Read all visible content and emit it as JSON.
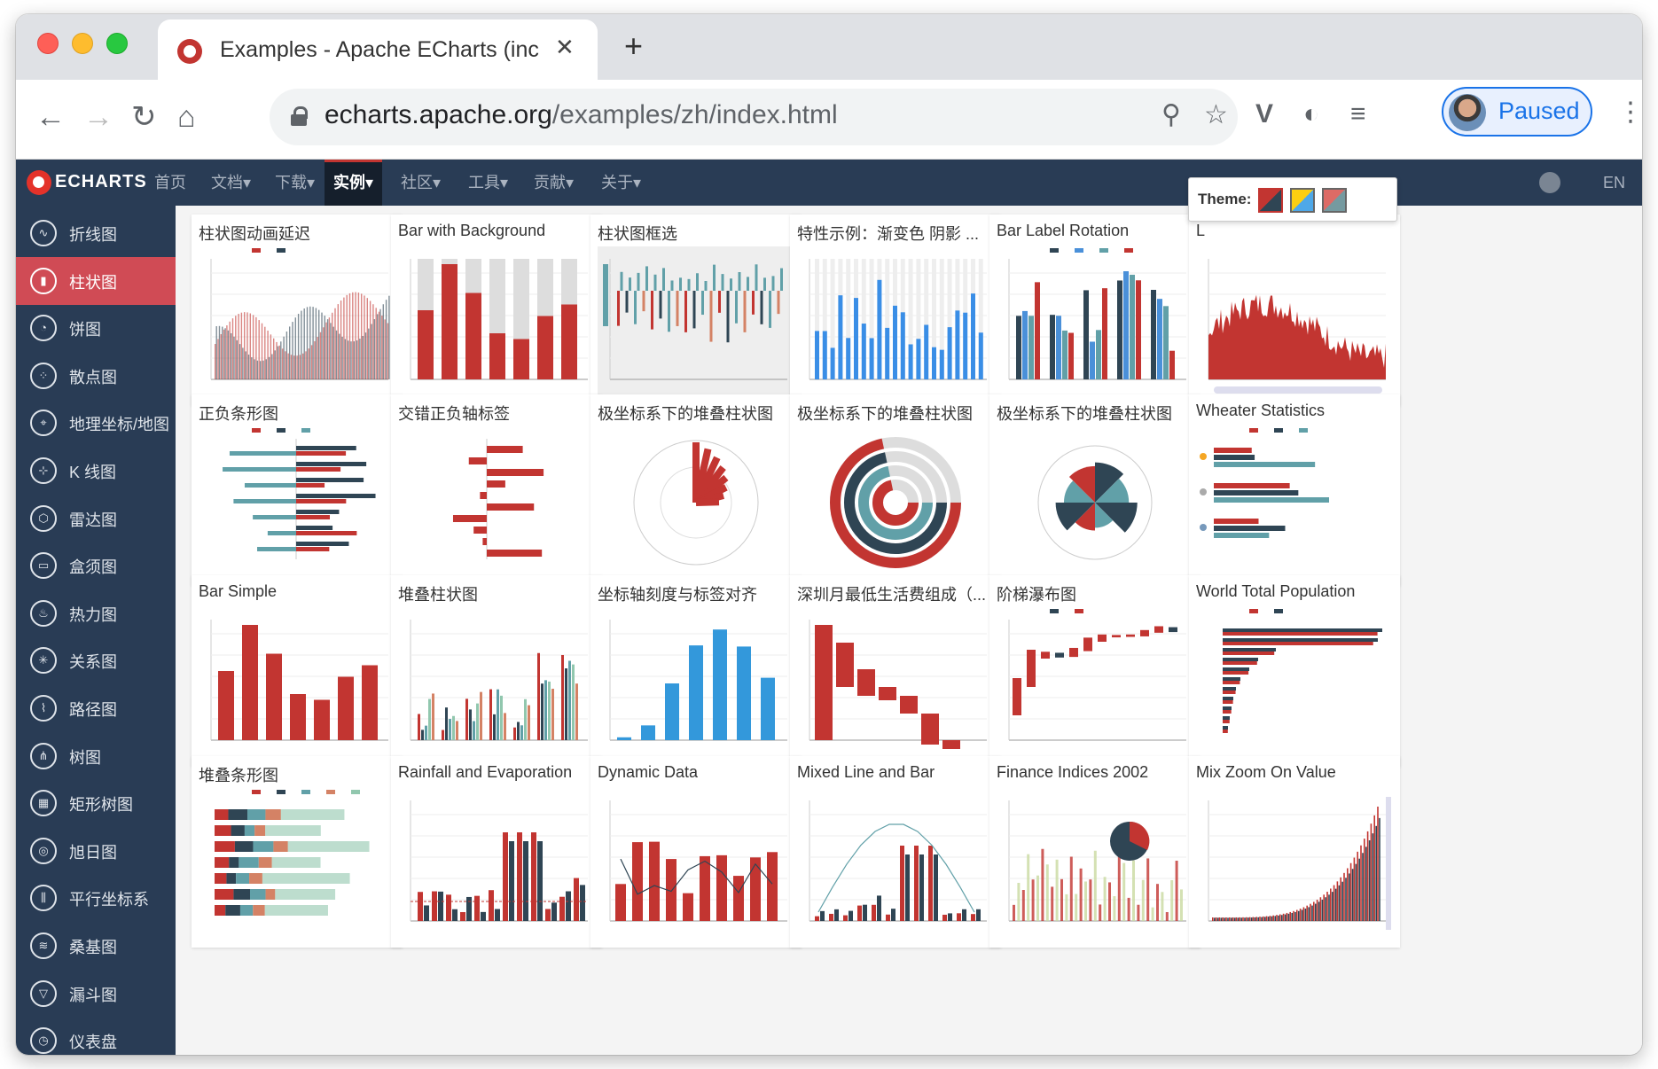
{
  "browser": {
    "tab_title": "Examples - Apache ECharts (incubating)",
    "url_host": "echarts.apache.org",
    "url_path": "/examples/zh/index.html",
    "profile_status": "Paused"
  },
  "topnav": {
    "logo": "ECHARTS",
    "items": [
      "首页",
      "文档",
      "下载",
      "实例",
      "社区",
      "工具",
      "贡献",
      "关于"
    ],
    "active": "实例",
    "lang": "EN"
  },
  "sidebar": {
    "items": [
      {
        "label": "折线图",
        "icon": "line-chart-icon"
      },
      {
        "label": "柱状图",
        "icon": "bar-chart-icon",
        "active": true
      },
      {
        "label": "饼图",
        "icon": "pie-chart-icon"
      },
      {
        "label": "散点图",
        "icon": "scatter-chart-icon"
      },
      {
        "label": "地理坐标/地图",
        "icon": "map-icon"
      },
      {
        "label": "K 线图",
        "icon": "candlestick-icon"
      },
      {
        "label": "雷达图",
        "icon": "radar-icon"
      },
      {
        "label": "盒须图",
        "icon": "boxplot-icon"
      },
      {
        "label": "热力图",
        "icon": "heatmap-icon"
      },
      {
        "label": "关系图",
        "icon": "graph-icon"
      },
      {
        "label": "路径图",
        "icon": "lines-icon"
      },
      {
        "label": "树图",
        "icon": "tree-icon"
      },
      {
        "label": "矩形树图",
        "icon": "treemap-icon"
      },
      {
        "label": "旭日图",
        "icon": "sunburst-icon"
      },
      {
        "label": "平行坐标系",
        "icon": "parallel-icon"
      },
      {
        "label": "桑基图",
        "icon": "sankey-icon"
      },
      {
        "label": "漏斗图",
        "icon": "funnel-icon"
      },
      {
        "label": "仪表盘",
        "icon": "gauge-icon"
      }
    ]
  },
  "theme_picker": {
    "label": "Theme:"
  },
  "cards": [
    {
      "title": "柱状图动画延迟",
      "kind": "wave"
    },
    {
      "title": "Bar with Background",
      "kind": "bgbar"
    },
    {
      "title": "柱状图框选",
      "kind": "brush"
    },
    {
      "title": "特性示例：渐变色 阴影 ...",
      "kind": "gradient"
    },
    {
      "title": "Bar Label Rotation",
      "kind": "grouped"
    },
    {
      "title": "L",
      "kind": "area"
    },
    {
      "title": "正负条形图",
      "kind": "hbar"
    },
    {
      "title": "交错正负轴标签",
      "kind": "hneg"
    },
    {
      "title": "极坐标系下的堆叠柱状图",
      "kind": "polar1"
    },
    {
      "title": "极坐标系下的堆叠柱状图",
      "kind": "polar2"
    },
    {
      "title": "极坐标系下的堆叠柱状图",
      "kind": "polar3"
    },
    {
      "title": "Wheater Statistics",
      "kind": "weather"
    },
    {
      "title": "Bar Simple",
      "kind": "simple"
    },
    {
      "title": "堆叠柱状图",
      "kind": "stacked"
    },
    {
      "title": "坐标轴刻度与标签对齐",
      "kind": "blue"
    },
    {
      "title": "深圳月最低生活费组成（...",
      "kind": "waterfall"
    },
    {
      "title": "阶梯瀑布图",
      "kind": "stair"
    },
    {
      "title": "World Total Population",
      "kind": "population"
    },
    {
      "title": "堆叠条形图",
      "kind": "stackh"
    },
    {
      "title": "Rainfall and Evaporation",
      "kind": "rain"
    },
    {
      "title": "Dynamic Data",
      "kind": "dynamic"
    },
    {
      "title": "Mixed Line and Bar",
      "kind": "mixed"
    },
    {
      "title": "Finance Indices 2002",
      "kind": "finance"
    },
    {
      "title": "Mix Zoom On Value",
      "kind": "zoom"
    }
  ]
}
